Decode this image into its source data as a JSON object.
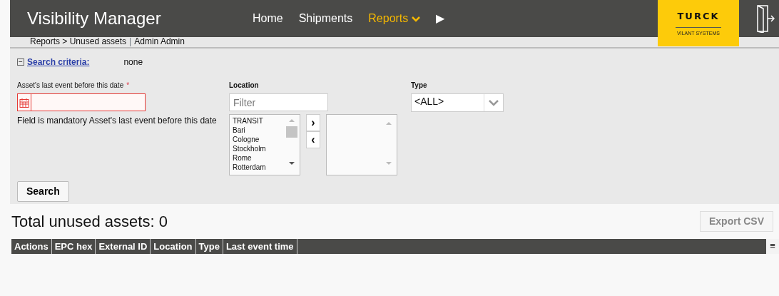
{
  "header": {
    "title": "Visibility Manager",
    "nav": [
      {
        "label": "Home",
        "selected": false,
        "dropdown": false
      },
      {
        "label": "Shipments",
        "selected": false,
        "dropdown": false
      },
      {
        "label": "Reports",
        "selected": true,
        "dropdown": true
      },
      {
        "label": "▶",
        "selected": false,
        "dropdown": false
      }
    ],
    "logo": {
      "brand": "TURCK",
      "subtitle": "VILANT SYSTEMS"
    }
  },
  "breadcrumb": {
    "path": "Reports > Unused assets",
    "separator": "|",
    "user": "Admin Admin"
  },
  "search_criteria": {
    "toggle": "−",
    "label": "Search criteria:",
    "summary": "none"
  },
  "date_field": {
    "label": "Asset's last event before this date",
    "required_mark": "*",
    "invalid": true,
    "error": "Field is mandatory Asset's last event before this date"
  },
  "location": {
    "label": "Location",
    "placeholder": "Filter",
    "available": [
      "TRANSIT",
      "Bari",
      "Cologne",
      "Stockholm",
      "Rome",
      "Rotterdam"
    ],
    "add_button": "›",
    "remove_button": "‹"
  },
  "type": {
    "label": "Type",
    "value": "<ALL>"
  },
  "search_button": "Search",
  "results": {
    "title": "Total unused assets: 0",
    "export_button": {
      "label": "Export CSV",
      "disabled": true
    },
    "columns": [
      "Actions",
      "EPC hex",
      "External ID",
      "Location",
      "Type",
      "Last event time"
    ],
    "menu_icon": "≡"
  }
}
